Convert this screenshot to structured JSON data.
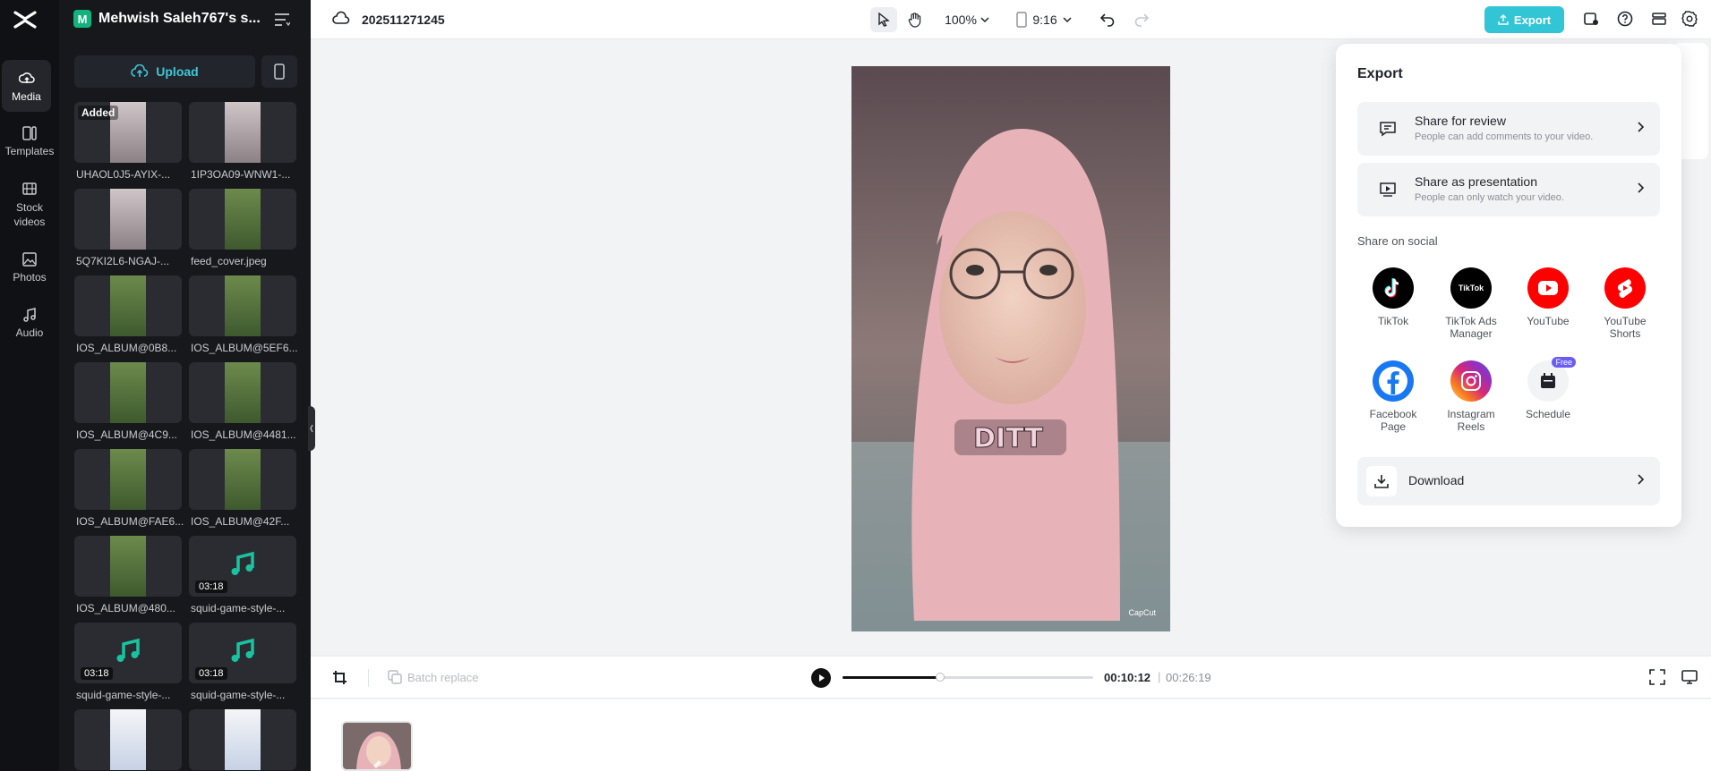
{
  "app": {
    "brand": "CapCut"
  },
  "rail": {
    "items": [
      {
        "label": "Media",
        "icon": "cloud-upload-icon"
      },
      {
        "label": "Templates",
        "icon": "templates-icon"
      },
      {
        "label": "Stock videos",
        "icon": "film-icon"
      },
      {
        "label": "Photos",
        "icon": "photo-icon"
      },
      {
        "label": "Audio",
        "icon": "music-icon"
      }
    ]
  },
  "project": {
    "initial": "M",
    "name": "Mehwish Saleh767's s..."
  },
  "media": {
    "upload_label": "Upload",
    "items": [
      {
        "name": "UHAOL0J5-AYIX-...",
        "badge": "Added",
        "kind": "portrait"
      },
      {
        "name": "1IP3OA09-WNW1-...",
        "kind": "portrait"
      },
      {
        "name": "5Q7KI2L6-NGAJ-...",
        "kind": "portrait"
      },
      {
        "name": "feed_cover.jpeg",
        "kind": "nature"
      },
      {
        "name": "IOS_ALBUM@0B8...",
        "kind": "nature"
      },
      {
        "name": "IOS_ALBUM@5EF6...",
        "kind": "nature"
      },
      {
        "name": "IOS_ALBUM@4C9...",
        "kind": "nature"
      },
      {
        "name": "IOS_ALBUM@4481...",
        "kind": "nature"
      },
      {
        "name": "IOS_ALBUM@FAE6...",
        "kind": "nature"
      },
      {
        "name": "IOS_ALBUM@42F...",
        "kind": "nature"
      },
      {
        "name": "IOS_ALBUM@480...",
        "kind": "nature"
      },
      {
        "name": "squid-game-style-...",
        "kind": "audio",
        "duration": "03:18"
      },
      {
        "name": "squid-game-style-...",
        "kind": "audio",
        "duration": "03:18"
      },
      {
        "name": "squid-game-style-...",
        "kind": "audio",
        "duration": "03:18"
      },
      {
        "name": "",
        "kind": "screenshot"
      },
      {
        "name": "",
        "kind": "screenshot"
      }
    ]
  },
  "topbar": {
    "title": "202511271245",
    "zoom": "100%",
    "ratio": "9:16",
    "export_label": "Export"
  },
  "player": {
    "watermark": "CapCut",
    "sticker_text": "DITT"
  },
  "bottombar": {
    "batch_replace": "Batch replace",
    "current_time": "00:10:12",
    "separator": "|",
    "total_time": "00:26:19",
    "progress": 0.39
  },
  "export_panel": {
    "title": "Export",
    "share_review": {
      "title": "Share for review",
      "subtitle": "People can add comments to your video."
    },
    "share_presentation": {
      "title": "Share as presentation",
      "subtitle": "People can only watch your video."
    },
    "social_label": "Share on social",
    "socials": [
      {
        "label": "TikTok",
        "icon": "tiktok-icon",
        "color": "#000000"
      },
      {
        "label": "TikTok Ads Manager",
        "icon": "tiktok-ads-icon",
        "color": "#000000",
        "inner": "TikTok"
      },
      {
        "label": "YouTube",
        "icon": "youtube-icon",
        "color": "#ff0000"
      },
      {
        "label": "YouTube Shorts",
        "icon": "youtube-shorts-icon",
        "color": "#ff0000"
      },
      {
        "label": "Facebook Page",
        "icon": "facebook-icon",
        "color": "#1877f2"
      },
      {
        "label": "Instagram Reels",
        "icon": "instagram-icon",
        "color": "#d62976"
      },
      {
        "label": "Schedule",
        "icon": "calendar-icon",
        "color": "#f2f3f5",
        "badge": "Free"
      }
    ],
    "download_label": "Download"
  }
}
